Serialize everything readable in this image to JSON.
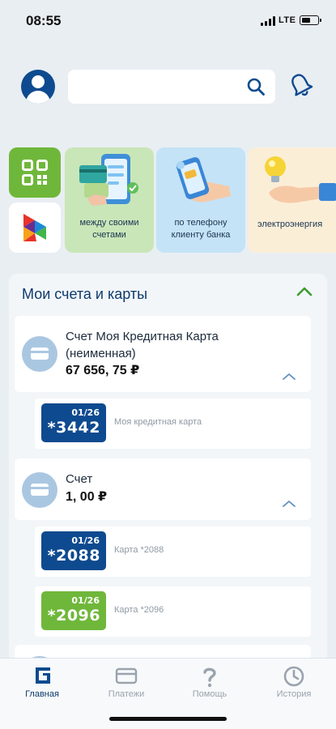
{
  "status_bar": {
    "time": "08:55",
    "network": "LTE"
  },
  "header": {
    "search": {
      "value": "",
      "placeholder": ""
    },
    "icons": [
      "avatar-icon",
      "search-icon",
      "bell-icon"
    ]
  },
  "quick_actions": {
    "tiles": [
      "qr-icon",
      "app-logo-icon"
    ],
    "promos": [
      {
        "label": "между своими счетами"
      },
      {
        "label": "по телефону клиенту банка"
      },
      {
        "label": "электроэнергия"
      }
    ]
  },
  "accounts": {
    "title": "Мои счета и карты",
    "items": [
      {
        "name_line1": "Счет Моя Кредитная Карта",
        "name_line2": "(неименная)",
        "amount": "67 656, 75 ₽",
        "cards": [
          {
            "expiry": "01/26",
            "number": "*3442",
            "label": "Моя кредитная карта",
            "color": "#0e4a8f"
          }
        ]
      },
      {
        "name_line1": "Счет",
        "amount": "1, 00 ₽",
        "cards": [
          {
            "expiry": "01/26",
            "number": "*2088",
            "label": "Карта *2088",
            "color": "#0e4a8f"
          },
          {
            "expiry": "01/26",
            "number": "*2096",
            "label": "Карта *2096",
            "color": "#6fb73a"
          }
        ]
      }
    ]
  },
  "bottom_nav": {
    "items": [
      {
        "label": "Главная",
        "icon": "home-icon",
        "active": true
      },
      {
        "label": "Платежи",
        "icon": "card-icon",
        "active": false
      },
      {
        "label": "Помощь",
        "icon": "question-icon",
        "active": false
      },
      {
        "label": "История",
        "icon": "clock-icon",
        "active": false
      }
    ]
  },
  "colors": {
    "primary": "#0e4a8f",
    "accent_green": "#6fb73a",
    "background": "#e9eef3"
  }
}
